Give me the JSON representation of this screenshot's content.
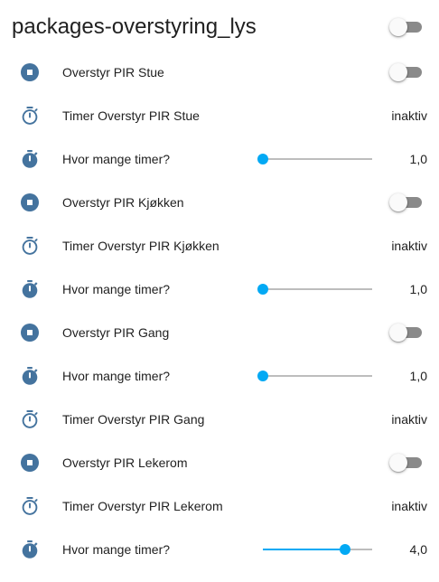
{
  "card": {
    "title": "packages-overstyring_lys",
    "master_toggle": {
      "on": false
    }
  },
  "colors": {
    "icon": "#44739e",
    "slider": "#03a9f4",
    "toggle_off_track": "#8a8a8a",
    "toggle_off_thumb": "#fafafa"
  },
  "slider_range": {
    "min": 1,
    "max": 5
  },
  "rows": [
    {
      "type": "toggle",
      "icon": "stop-circle-icon",
      "label": "Overstyr PIR Stue",
      "on": false
    },
    {
      "type": "timer",
      "icon": "timer-icon",
      "label": "Timer Overstyr PIR Stue",
      "value": "inaktiv"
    },
    {
      "type": "slider",
      "icon": "timer-filled-icon",
      "label": "Hvor mange timer?",
      "value": "1,0",
      "level": 1.0
    },
    {
      "type": "toggle",
      "icon": "stop-circle-icon",
      "label": "Overstyr PIR Kjøkken",
      "on": false
    },
    {
      "type": "timer",
      "icon": "timer-icon",
      "label": "Timer Overstyr PIR Kjøkken",
      "value": "inaktiv"
    },
    {
      "type": "slider",
      "icon": "timer-filled-icon",
      "label": "Hvor mange timer?",
      "value": "1,0",
      "level": 1.0
    },
    {
      "type": "toggle",
      "icon": "stop-circle-icon",
      "label": "Overstyr PIR Gang",
      "on": false
    },
    {
      "type": "slider",
      "icon": "timer-filled-icon",
      "label": "Hvor mange timer?",
      "value": "1,0",
      "level": 1.0
    },
    {
      "type": "timer",
      "icon": "timer-icon",
      "label": "Timer Overstyr PIR Gang",
      "value": "inaktiv"
    },
    {
      "type": "toggle",
      "icon": "stop-circle-icon",
      "label": "Overstyr PIR Lekerom",
      "on": false
    },
    {
      "type": "timer",
      "icon": "timer-icon",
      "label": "Timer Overstyr PIR Lekerom",
      "value": "inaktiv"
    },
    {
      "type": "slider",
      "icon": "timer-filled-icon",
      "label": "Hvor mange timer?",
      "value": "4,0",
      "level": 4.0
    }
  ]
}
